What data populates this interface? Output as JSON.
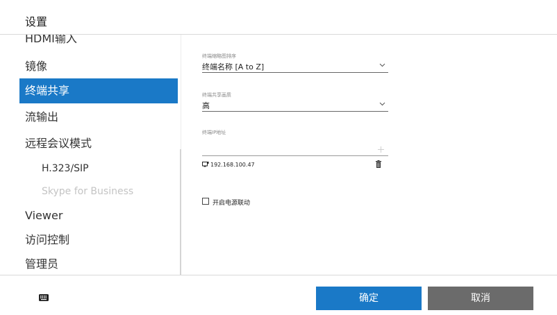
{
  "header": {
    "title": "设置"
  },
  "sidebar": {
    "items": [
      {
        "label": "HDMI输入"
      },
      {
        "label": "镜像"
      },
      {
        "label": "终端共享"
      },
      {
        "label": "流输出"
      },
      {
        "label": "远程会议模式"
      },
      {
        "label": "H.323/SIP"
      },
      {
        "label": "Skype for Business"
      },
      {
        "label": "Viewer"
      },
      {
        "label": "访问控制"
      },
      {
        "label": "管理员"
      }
    ],
    "active_index": 2,
    "colors": {
      "active_bg": "#1a79c7",
      "disabled_text": "#c4c4c4"
    }
  },
  "panel": {
    "sort": {
      "label": "终端缩略图排序",
      "value": "终端名称 [A to Z]",
      "icon": "chevron-down-icon"
    },
    "quality": {
      "label": "终端共享画质",
      "value": "高",
      "icon": "chevron-down-icon"
    },
    "ip": {
      "label": "终端IP地址",
      "value": "",
      "icon": "plus-icon"
    },
    "ip_list": [
      {
        "address": "192.168.100.47",
        "icon": "terminal-icon",
        "action_icon": "trash-icon"
      }
    ],
    "power_link": {
      "label": "开启电源联动",
      "checked": false
    }
  },
  "footer": {
    "keyboard_icon": "keyboard-icon",
    "ok_label": "确定",
    "cancel_label": "取消",
    "colors": {
      "ok_bg": "#1a79c7",
      "cancel_bg": "#6b6b6b"
    }
  }
}
